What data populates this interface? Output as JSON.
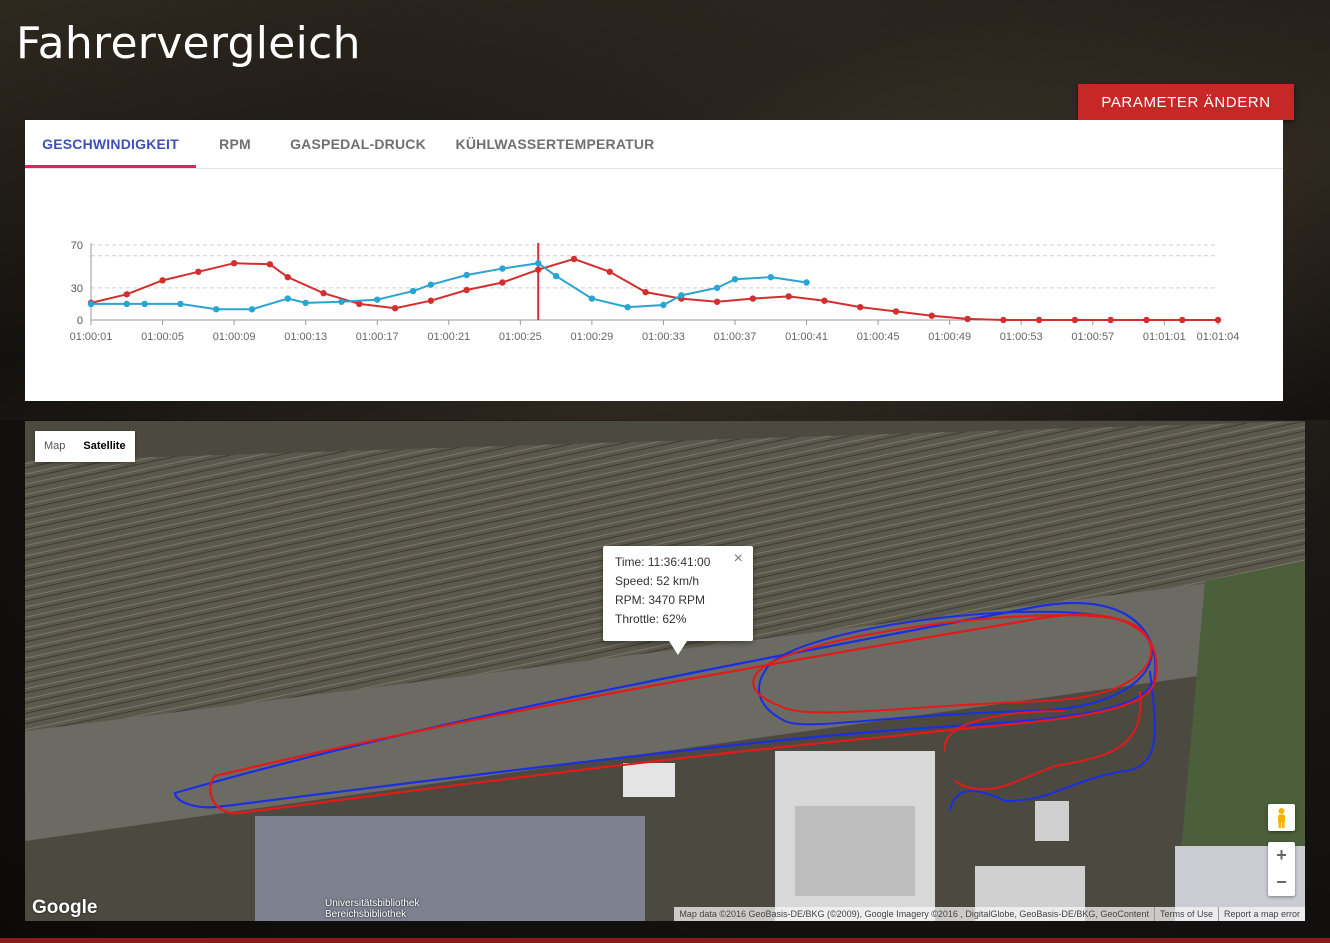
{
  "page": {
    "title": "Fahrervergleich"
  },
  "toolbar": {
    "param_button": "PARAMETER ÄNDERN"
  },
  "tabs": [
    {
      "label": "GESCHWINDIGKEIT",
      "active": true
    },
    {
      "label": "RPM",
      "active": false
    },
    {
      "label": "GASPEDAL-DRUCK",
      "active": false
    },
    {
      "label": "KÜHLWASSERTEMPERATUR",
      "active": false
    }
  ],
  "colors": {
    "accent": "#c62828",
    "tab_active": "#3f51b5",
    "tab_indicator": "#e91e63",
    "series_red": "#d32f2f",
    "series_blue": "#2aa4d1"
  },
  "chart_data": {
    "type": "line",
    "ylim": [
      0,
      70
    ],
    "yticks": [
      0,
      30,
      70
    ],
    "x_ticks": [
      "01:00:01",
      "01:00:05",
      "01:00:09",
      "01:00:13",
      "01:00:17",
      "01:00:21",
      "01:00:25",
      "01:00:29",
      "01:00:33",
      "01:00:37",
      "01:00:41",
      "01:00:45",
      "01:00:49",
      "01:00:53",
      "01:00:57",
      "01:01:01",
      "01:01:04"
    ],
    "x_min_seconds": 1,
    "x_max_seconds": 64,
    "cursor_x": "01:00:26",
    "grid": true,
    "series": [
      {
        "color": "#d32f2f",
        "x": [
          "01:00:01",
          "01:00:03",
          "01:00:05",
          "01:00:07",
          "01:00:09",
          "01:00:11",
          "01:00:12",
          "01:00:14",
          "01:00:16",
          "01:00:18",
          "01:00:20",
          "01:00:22",
          "01:00:24",
          "01:00:26",
          "01:00:28",
          "01:00:30",
          "01:00:32",
          "01:00:34",
          "01:00:36",
          "01:00:38",
          "01:00:40",
          "01:00:42",
          "01:00:44",
          "01:00:46",
          "01:00:48",
          "01:00:50",
          "01:00:52",
          "01:00:54",
          "01:00:56",
          "01:00:58",
          "01:01:00",
          "01:01:02",
          "01:01:04"
        ],
        "values": [
          16,
          24,
          37,
          45,
          53,
          52,
          40,
          25,
          15,
          11,
          18,
          28,
          35,
          47,
          57,
          45,
          26,
          20,
          17,
          20,
          22,
          18,
          12,
          8,
          4,
          1,
          0,
          0,
          0,
          0,
          0,
          0,
          0
        ]
      },
      {
        "color": "#2aa4d1",
        "x": [
          "01:00:01",
          "01:00:03",
          "01:00:04",
          "01:00:06",
          "01:00:08",
          "01:00:10",
          "01:00:12",
          "01:00:13",
          "01:00:15",
          "01:00:17",
          "01:00:19",
          "01:00:20",
          "01:00:22",
          "01:00:24",
          "01:00:26",
          "01:00:27",
          "01:00:29",
          "01:00:31",
          "01:00:33",
          "01:00:34",
          "01:00:36",
          "01:00:37",
          "01:00:39",
          "01:00:41"
        ],
        "values": [
          15,
          15,
          15,
          15,
          10,
          10,
          20,
          16,
          17,
          19,
          27,
          33,
          42,
          48,
          53,
          41,
          20,
          12,
          14,
          23,
          30,
          38,
          40,
          35
        ]
      }
    ]
  },
  "map": {
    "type_control": {
      "map_label": "Map",
      "satellite_label": "Satellite",
      "selected": "Satellite"
    },
    "info_window": {
      "lines": [
        "Time: 11:36:41:00",
        "Speed: 52 km/h",
        "RPM: 3470 RPM",
        "Throttle: 62%"
      ],
      "close": "×"
    },
    "zoom_in": "+",
    "zoom_out": "−",
    "logo": "Google",
    "poi_label": "Universitätsbibliothek Bereichsbibliothek",
    "attribution": {
      "data": "Map data ©2016 GeoBasis-DE/BKG (©2009), Google Imagery ©2016 , DigitalGlobe, GeoBasis-DE/BKG, GeoContent",
      "terms": "Terms of Use",
      "report": "Report a map error"
    },
    "pegman_icon": "pegman-icon",
    "track_colors": [
      "#e21a1a",
      "#1a2ee2"
    ]
  }
}
